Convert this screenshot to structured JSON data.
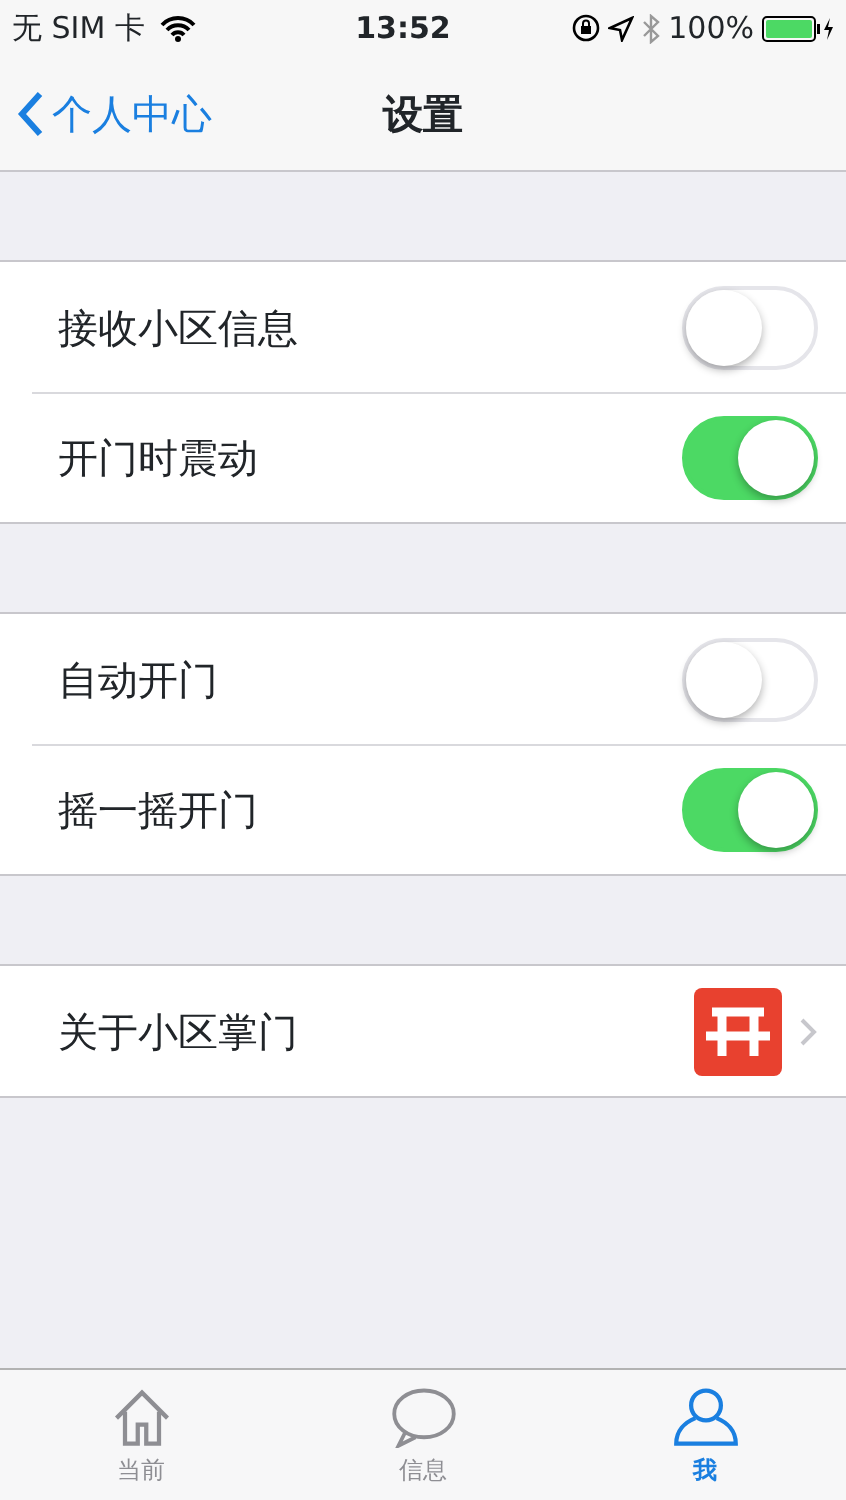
{
  "status_bar": {
    "carrier": "无 SIM 卡",
    "time": "13:52",
    "battery": "100%"
  },
  "nav": {
    "back": "个人中心",
    "title": "设置"
  },
  "groups": [
    {
      "rows": [
        {
          "kind": "toggle",
          "label": "接收小区信息",
          "on": false
        },
        {
          "kind": "toggle",
          "label": "开门时震动",
          "on": true
        }
      ]
    },
    {
      "rows": [
        {
          "kind": "toggle",
          "label": "自动开门",
          "on": false
        },
        {
          "kind": "toggle",
          "label": "摇一摇开门",
          "on": true
        }
      ]
    },
    {
      "rows": [
        {
          "kind": "link",
          "label": "关于小区掌门"
        }
      ]
    }
  ],
  "tab_bar": [
    {
      "label": "当前",
      "kind": "home",
      "selected": false
    },
    {
      "label": "信息",
      "kind": "chat",
      "selected": false
    },
    {
      "label": "我",
      "kind": "person",
      "selected": true
    }
  ]
}
